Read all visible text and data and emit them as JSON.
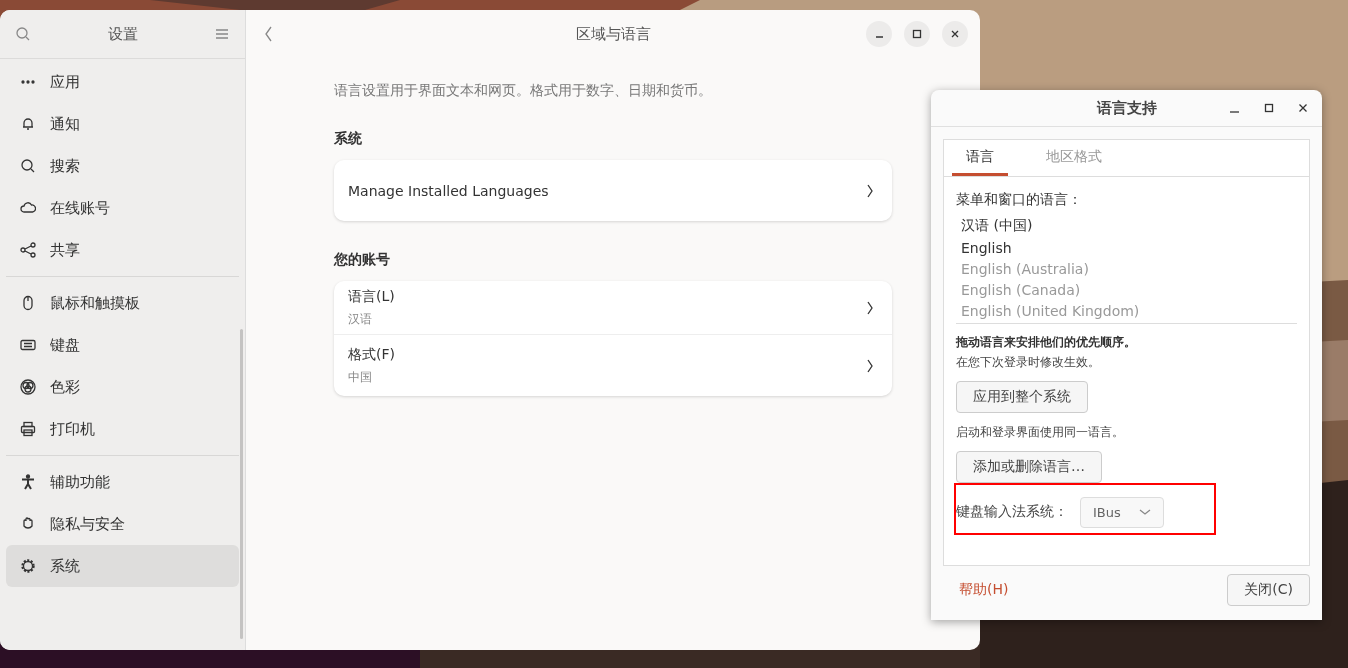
{
  "settings_window": {
    "sidebar": {
      "title": "设置",
      "groups": [
        [
          {
            "label": "应用",
            "selected": false
          },
          {
            "label": "通知",
            "selected": false
          },
          {
            "label": "搜索",
            "selected": false
          },
          {
            "label": "在线账号",
            "selected": false
          },
          {
            "label": "共享",
            "selected": false
          }
        ],
        [
          {
            "label": "鼠标和触摸板",
            "selected": false
          },
          {
            "label": "键盘",
            "selected": false
          },
          {
            "label": "色彩",
            "selected": false
          },
          {
            "label": "打印机",
            "selected": false
          }
        ],
        [
          {
            "label": "辅助功能",
            "selected": false
          },
          {
            "label": "隐私与安全",
            "selected": false
          },
          {
            "label": "系统",
            "selected": true
          }
        ]
      ]
    },
    "title": "区域与语言",
    "description": "语言设置用于界面文本和网页。格式用于数字、日期和货币。",
    "sections": [
      {
        "heading": "系统",
        "rows": [
          {
            "title": "Manage Installed Languages"
          }
        ]
      },
      {
        "heading": "您的账号",
        "rows": [
          {
            "title": "语言(L)",
            "subtitle": "汉语"
          },
          {
            "title": "格式(F)",
            "subtitle": "中国"
          }
        ]
      }
    ]
  },
  "language_dialog": {
    "title": "语言支持",
    "tabs": [
      {
        "label": "语言",
        "selected": true
      },
      {
        "label": "地区格式",
        "selected": false
      }
    ],
    "list_label": "菜单和窗口的语言：",
    "languages": [
      {
        "name": "汉语 (中国)",
        "greyed": false
      },
      {
        "name": "English",
        "greyed": false
      },
      {
        "name": "English (Australia)",
        "greyed": true
      },
      {
        "name": "English (Canada)",
        "greyed": true
      },
      {
        "name": "English (United Kingdom)",
        "greyed": true
      }
    ],
    "drag_hint": "拖动语言来安排他们的优先顺序。",
    "login_hint": "在您下次登录时修改生效。",
    "apply_button": "应用到整个系统",
    "boot_hint": "启动和登录界面使用同一语言。",
    "add_remove_button": "添加或删除语言…",
    "keyboard_input": {
      "label": "键盘输入法系统：",
      "value": "IBus",
      "highlighted": true
    },
    "help_button": "帮助(H)",
    "close_button": "关闭(C)"
  }
}
